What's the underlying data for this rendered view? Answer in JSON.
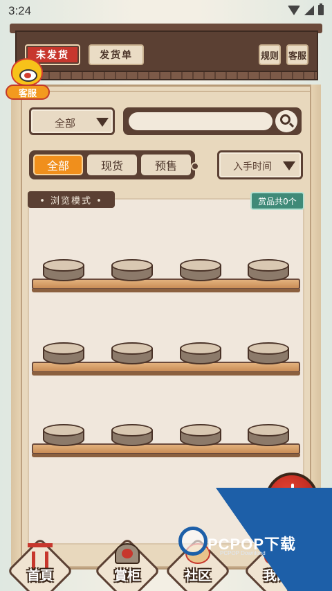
{
  "status_bar": {
    "time": "3:24"
  },
  "header": {
    "unshipped_label": "未发货",
    "shipping_slip_label": "发货单",
    "rules_label": "规则",
    "service_label": "客服"
  },
  "mascot": {
    "label": "客服"
  },
  "filters": {
    "category_selected": "全部",
    "search_placeholder": "",
    "tabs": [
      {
        "label": "全部",
        "active": true
      },
      {
        "label": "现货",
        "active": false
      },
      {
        "label": "预售",
        "active": false
      }
    ],
    "sort_selected": "入手时间"
  },
  "browse": {
    "mode_label": "• 浏览模式 •",
    "count_label": "赏品共0个"
  },
  "shelves": [
    {
      "pedestals": 4
    },
    {
      "pedestals": 4
    },
    {
      "pedestals": 4
    }
  ],
  "bottom_nav": [
    {
      "label": "首頁",
      "icon": "torii-icon"
    },
    {
      "label": "賞柜",
      "icon": "cabinet-icon"
    },
    {
      "label": "社区",
      "icon": "community-icon"
    },
    {
      "label": "我的",
      "icon": "profile-icon"
    }
  ],
  "watermark": {
    "text": "PCPOP下载",
    "sub": "PCPOP Download"
  },
  "colors": {
    "dark_wood": "#5b4033",
    "accent_orange": "#f08f1c",
    "accent_red": "#c7372d",
    "count_green": "#3f8a78",
    "panel_bg": "#f0e7dc"
  }
}
